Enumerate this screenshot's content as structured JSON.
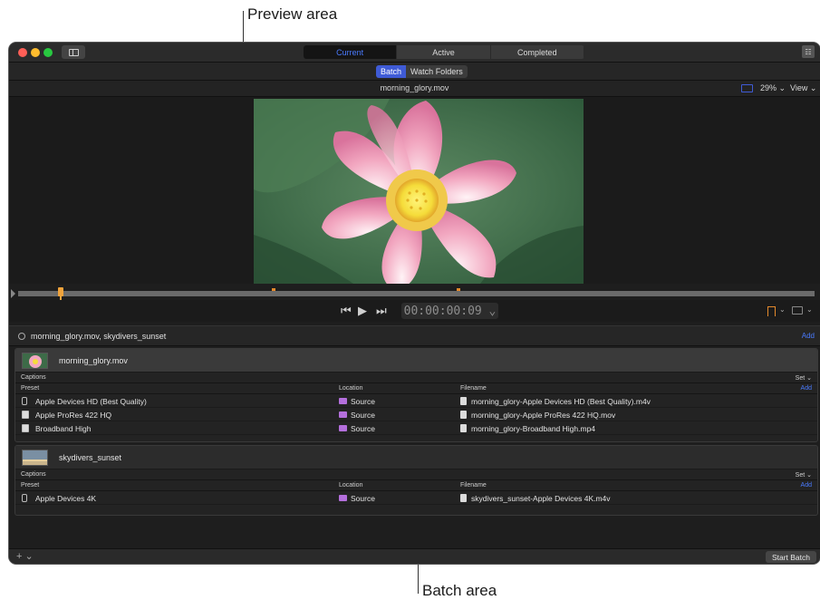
{
  "callouts": {
    "preview": "Preview area",
    "batch": "Batch area"
  },
  "toolbar": {
    "tabs": [
      {
        "label": "Current"
      },
      {
        "label": "Active"
      },
      {
        "label": "Completed"
      }
    ],
    "sidebar_icon": "sidebar-toggle-icon",
    "inspector_icon": "inspector-toggle-icon"
  },
  "subbar": {
    "batch_label": "Batch",
    "watch_label": "Watch Folders"
  },
  "preview": {
    "filename": "morning_glory.mov",
    "zoom": "29% ⌄",
    "view": "View ⌄",
    "timecode": "00:00:00:09 ⌄"
  },
  "batch": {
    "group_label": "morning_glory.mov, skydivers_sunset",
    "add_label": "Add",
    "jobs": [
      {
        "name": "morning_glory.mov",
        "captions_label": "Captions",
        "set_label": "Set ⌄",
        "headers": {
          "preset": "Preset",
          "location": "Location",
          "filename": "Filename",
          "add": "Add"
        },
        "rows": [
          {
            "preset": "Apple Devices HD (Best Quality)",
            "location": "Source",
            "filename": "morning_glory-Apple Devices HD (Best Quality).m4v"
          },
          {
            "preset": "Apple ProRes 422 HQ",
            "location": "Source",
            "filename": "morning_glory-Apple ProRes 422 HQ.mov"
          },
          {
            "preset": "Broadband High",
            "location": "Source",
            "filename": "morning_glory-Broadband High.mp4"
          }
        ]
      },
      {
        "name": "skydivers_sunset",
        "captions_label": "Captions",
        "set_label": "Set ⌄",
        "headers": {
          "preset": "Preset",
          "location": "Location",
          "filename": "Filename",
          "add": "Add"
        },
        "rows": [
          {
            "preset": "Apple Devices 4K",
            "location": "Source",
            "filename": "skydivers_sunset-Apple Devices 4K.m4v"
          }
        ]
      }
    ]
  },
  "bottom": {
    "add_menu": "+ ⌄",
    "start_batch": "Start Batch"
  },
  "colors": {
    "accent": "#3f5bd6",
    "marker": "#e58a2c",
    "folder": "#b46fdc"
  }
}
